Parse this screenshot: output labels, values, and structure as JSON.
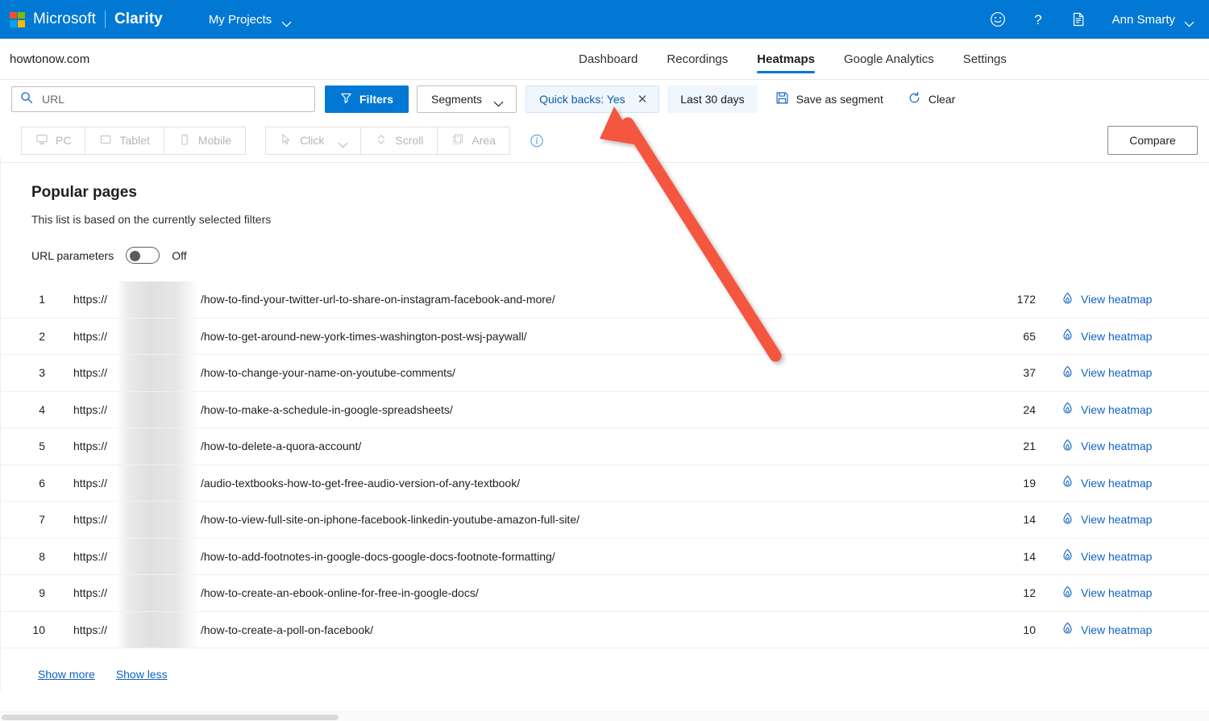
{
  "topbar": {
    "brand_microsoft": "Microsoft",
    "brand_product": "Clarity",
    "projects_label": "My Projects",
    "icons": [
      "smiley-icon",
      "help-icon",
      "document-icon"
    ],
    "user_name": "Ann Smarty"
  },
  "navrow": {
    "site_name": "howtonow.com",
    "tabs": [
      {
        "label": "Dashboard",
        "active": false
      },
      {
        "label": "Recordings",
        "active": false
      },
      {
        "label": "Heatmaps",
        "active": true
      },
      {
        "label": "Google Analytics",
        "active": false
      },
      {
        "label": "Settings",
        "active": false
      }
    ]
  },
  "filterbar": {
    "search_value": "",
    "search_placeholder": "URL",
    "filters_label": "Filters",
    "segments_label": "Segments",
    "chip_label": "Quick backs: Yes",
    "chip_close": "✕",
    "date_range": "Last 30 days",
    "save_segment_label": "Save as segment",
    "clear_label": "Clear"
  },
  "toolrow": {
    "devices": [
      "PC",
      "Tablet",
      "Mobile"
    ],
    "modes": [
      "Click",
      "Scroll",
      "Area"
    ],
    "compare_label": "Compare"
  },
  "main": {
    "title": "Popular pages",
    "subtitle": "This list is based on the currently selected filters",
    "url_params_label": "URL parameters",
    "url_params_state": "Off",
    "protocol_text": "https://",
    "view_heatmap_label": "View heatmap",
    "show_more_label": "Show more",
    "show_less_label": "Show less",
    "rows": [
      {
        "rank": "1",
        "path": "/how-to-find-your-twitter-url-to-share-on-instagram-facebook-and-more/",
        "count": "172"
      },
      {
        "rank": "2",
        "path": "/how-to-get-around-new-york-times-washington-post-wsj-paywall/",
        "count": "65"
      },
      {
        "rank": "3",
        "path": "/how-to-change-your-name-on-youtube-comments/",
        "count": "37"
      },
      {
        "rank": "4",
        "path": "/how-to-make-a-schedule-in-google-spreadsheets/",
        "count": "24"
      },
      {
        "rank": "5",
        "path": "/how-to-delete-a-quora-account/",
        "count": "21"
      },
      {
        "rank": "6",
        "path": "/audio-textbooks-how-to-get-free-audio-version-of-any-textbook/",
        "count": "19"
      },
      {
        "rank": "7",
        "path": "/how-to-view-full-site-on-iphone-facebook-linkedin-youtube-amazon-full-site/",
        "count": "14"
      },
      {
        "rank": "8",
        "path": "/how-to-add-footnotes-in-google-docs-google-docs-footnote-formatting/",
        "count": "14"
      },
      {
        "rank": "9",
        "path": "/how-to-create-an-ebook-online-for-free-in-google-docs/",
        "count": "12"
      },
      {
        "rank": "10",
        "path": "/how-to-create-a-poll-on-facebook/",
        "count": "10"
      }
    ]
  },
  "annotation": {
    "type": "arrow",
    "color": "#f4573f",
    "points_at": "Quick backs: Yes"
  },
  "colors": {
    "brand_blue": "#0078d4",
    "link_blue": "#0f62c4",
    "chip_bg": "#eff6fc",
    "arrow_red": "#f4573f"
  }
}
